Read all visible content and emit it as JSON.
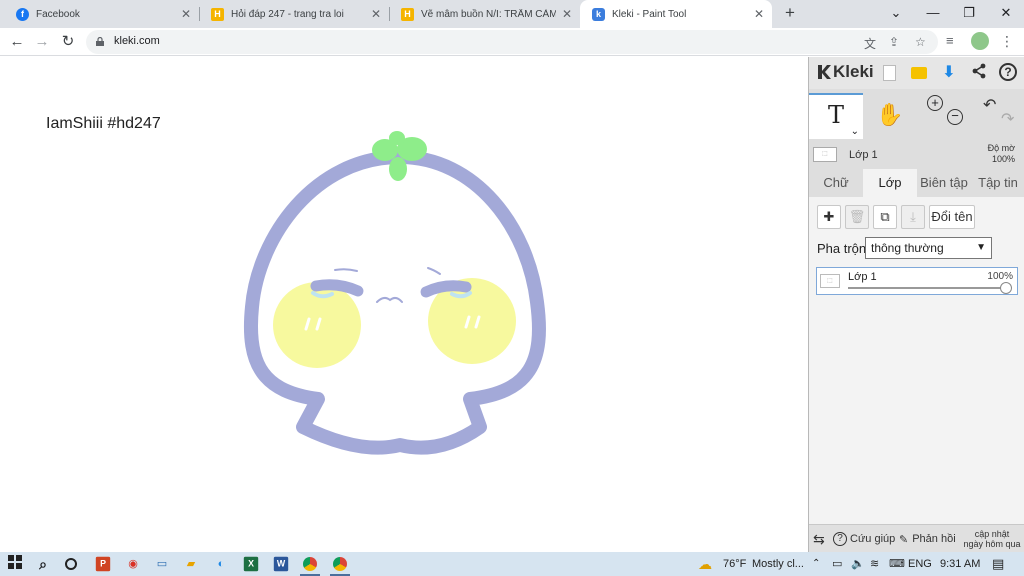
{
  "browser": {
    "tabs": [
      {
        "title": "Facebook",
        "icon": "facebook-icon",
        "color": "#1877f2",
        "active": false
      },
      {
        "title": "Hỏi đáp 247 - trang tra loi",
        "icon": "hoidap247-icon",
        "color": "#f5b400",
        "active": false
      },
      {
        "title": "Vẽ mâm buồn N/I: TRẦM CẢM :>",
        "icon": "hoidap247-icon",
        "color": "#f5b400",
        "active": false
      },
      {
        "title": "Kleki - Paint Tool",
        "icon": "kleki-icon",
        "color": "#3b7ddd",
        "active": true
      }
    ],
    "url": "kleki.com"
  },
  "canvas": {
    "text": "IamShiii #hd247",
    "colors": {
      "outline": "#a3a9d8",
      "cheek": "#f7f99e",
      "sprout": "#8eed8a",
      "eye": "#a3a9d8",
      "tear": "#bfe3f0"
    }
  },
  "kleki": {
    "logo_text": "Kleki",
    "layer_name": "Lớp 1",
    "opacity_label": "Độ mờ",
    "opacity_value": "100%",
    "tabs": [
      "Chữ",
      "Lớp",
      "Biên tập",
      "Tập tin"
    ],
    "active_tab": "Lớp",
    "rename_button": "Đổi tên",
    "blend_label": "Pha trộn",
    "blend_value": "thông thường",
    "layers": [
      {
        "name": "Lớp 1",
        "opacity": "100%",
        "opacity_fraction": 1.0
      }
    ],
    "help_label": "Cứu giúp",
    "feedback_label": "Phản hồi",
    "update_label_1": "cập nhật",
    "update_label_2": "ngày hôm qua"
  },
  "taskbar": {
    "weather_temp": "76°F",
    "weather_text": "Mostly cl...",
    "language": "ENG",
    "time": "9:31 AM"
  }
}
